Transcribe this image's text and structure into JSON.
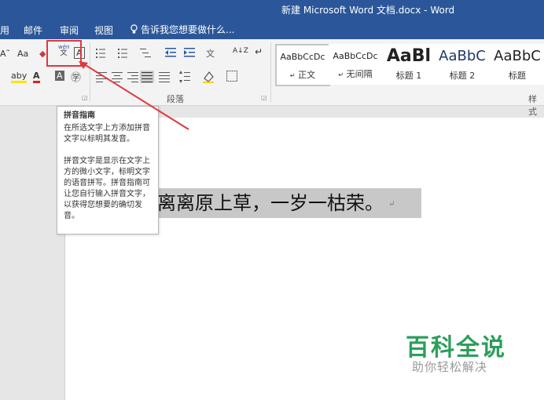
{
  "window": {
    "title": "新建 Microsoft Word 文档.docx - Word"
  },
  "tabs": [
    "用",
    "邮件",
    "审阅",
    "视图"
  ],
  "tell_me": "告诉我您想要做什么...",
  "ribbon": {
    "font_size_btn": "A˜",
    "case_btn": "Aa",
    "highlight_btn": "aby",
    "font_color_btn": "A",
    "char_shading": "A",
    "pinyin_top": "wén",
    "pinyin_bottom": "文",
    "border_char": "A",
    "paragraph_label": "段落",
    "styles_label": "样式",
    "sort_btn": "A↓Z",
    "pilcrow": "↵"
  },
  "styles": [
    {
      "preview": "AaBbCcDc",
      "name": "正文",
      "mark": "↵",
      "selected": true
    },
    {
      "preview": "AaBbCcDc",
      "name": "无间隔",
      "mark": "↵",
      "selected": false
    },
    {
      "preview": "AaBl",
      "name": "标题 1",
      "mark": "",
      "selected": false
    },
    {
      "preview": "AaBbC",
      "name": "标题 2",
      "mark": "",
      "selected": false
    },
    {
      "preview": "AaBbC",
      "name": "标题",
      "mark": "",
      "selected": false
    }
  ],
  "tooltip": {
    "title": "拼音指南",
    "para1": "在所选文字上方添加拼音文字以标明其发音。",
    "para2": "拼音文字是显示在文字上方的微小文字，标明文字的语音拼写。拼音指南可让您自行输入拼音文字，以获得您想要的确切发音。"
  },
  "document": {
    "text": "离离原上草，一岁一枯荣。",
    "para_mark": "↵"
  },
  "watermark": {
    "main": "百科全说",
    "sub": "助你轻松解决"
  },
  "colors": {
    "title_bar": "#2b579a",
    "highlight_box": "#e0383e",
    "watermark": "#2d9e5b"
  }
}
